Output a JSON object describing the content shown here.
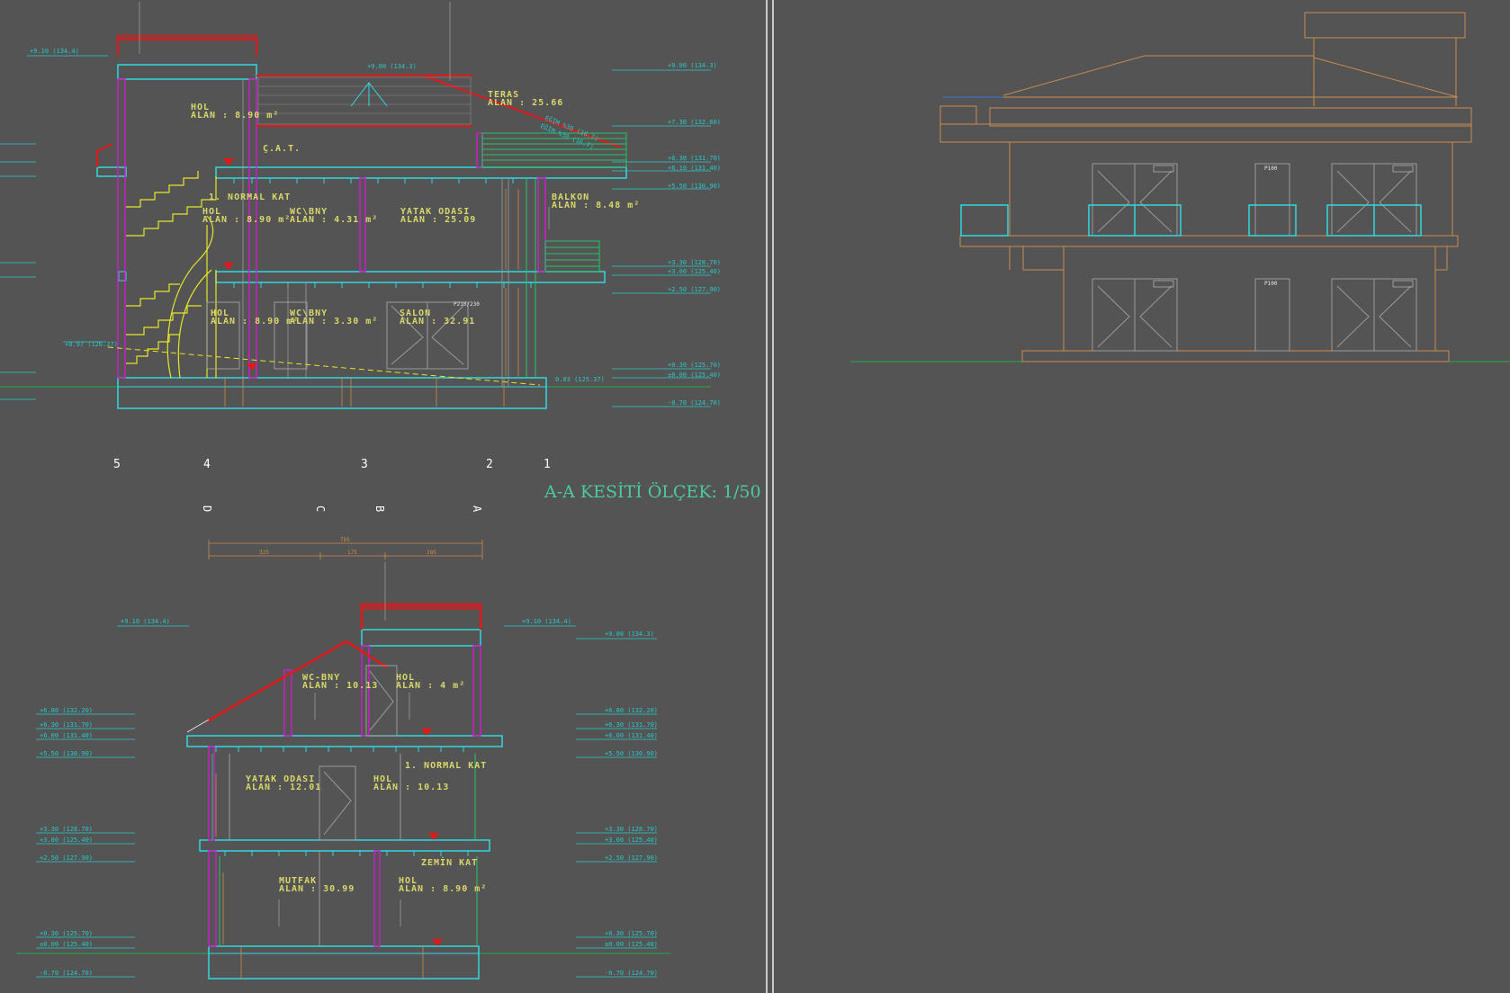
{
  "drawing": {
    "title": "A-A KESİTİ ÖLÇEK: 1/50",
    "axis_numbers": [
      "5",
      "4",
      "3",
      "2",
      "1"
    ],
    "axis_letters": [
      "D",
      "C",
      "B",
      "A"
    ],
    "colors": {
      "background": "#545454",
      "cyan": "#2fd9e0",
      "magenta": "#c81fc8",
      "yellow": "#e6e628",
      "red": "#e41818",
      "green": "#22c864",
      "orange": "#c88c50",
      "label_yellow": "#d8d86a",
      "elev_cyan": "#28c8c8",
      "title_green": "#4ccaa0",
      "white": "#e8e8e8",
      "gray": "#9a9a9a"
    }
  },
  "section_top": {
    "rooms": [
      {
        "name": "HOL",
        "area": "ALAN : 8.90 m²"
      },
      {
        "name": "TERAS",
        "area": "ALAN : 25.66"
      },
      {
        "name": "Ç.A.T.",
        "area": ""
      },
      {
        "name": "1. NORMAL KAT",
        "area": ""
      },
      {
        "name": "HOL",
        "area": "ALAN : 8.90 m²"
      },
      {
        "name": "WC\\BNY",
        "area": "ALAN : 4.31 m²"
      },
      {
        "name": "YATAK ODASI",
        "area": "ALAN : 25.09"
      },
      {
        "name": "BALKON",
        "area": "ALAN : 8.48 m²"
      },
      {
        "name": "HOL",
        "area": "ALAN : 8.90 m²"
      },
      {
        "name": "WC\\BNY",
        "area": "ALAN : 3.30 m²"
      },
      {
        "name": "SALON",
        "area": "ALAN : 32.91"
      }
    ],
    "elevations_left": [
      "+9.10 (134.4)",
      "+0.97 (126.27)"
    ],
    "elevations_right": [
      "+9.00 (134.3)",
      "+7.30 (132.60)",
      "+6.30 (131.70)",
      "+6.10 (131.40)",
      "+5.50 (130.90)",
      "+3.30 (128.70)",
      "+3.00 (125.40)",
      "+2.50 (127.90)",
      "+0.30 (125.70)",
      "±0.00 (125.40)",
      "-0.70 (124.70)"
    ],
    "roof_labels": [
      "+9.00 (134.3)",
      "EĞİM %30 (16.7)",
      "EĞİM %30 (16.7)"
    ],
    "misc": [
      "P210/230",
      "0.03 (125.37)"
    ]
  },
  "section_bottom": {
    "rooms": [
      {
        "name": "WC-BNY",
        "area": "ALAN : 10.13"
      },
      {
        "name": "HOL",
        "area": "ALAN : 4 m²"
      },
      {
        "name": "1. NORMAL KAT",
        "area": ""
      },
      {
        "name": "YATAK ODASI",
        "area": "ALAN : 12.01"
      },
      {
        "name": "HOL",
        "area": "ALAN : 10.13"
      },
      {
        "name": "ZEMİN KAT",
        "area": ""
      },
      {
        "name": "MUTFAK",
        "area": "ALAN : 30.99"
      },
      {
        "name": "HOL",
        "area": "ALAN : 8.90 m²"
      }
    ],
    "dimensions": [
      "785",
      "325",
      "175",
      "285"
    ],
    "elevations_left": [
      "+9.10 (134.4)",
      "+6.80 (132.20)",
      "+6.30 (131.70)",
      "+6.00 (131.40)",
      "+5.50 (130.90)",
      "+3.30 (128.70)",
      "+3.00 (125.40)",
      "+2.50 (127.90)",
      "+0.30 (125.70)",
      "±0.00 (125.40)",
      "-0.70 (124.70)"
    ],
    "elevations_right": [
      "+9.10 (134.4)",
      "+9.00 (134.3)",
      "+6.80 (132.20)",
      "+6.30 (131.70)",
      "+6.00 (131.40)",
      "+5.50 (130.90)",
      "+3.30 (128.70)",
      "+3.00 (125.40)",
      "+2.50 (127.90)",
      "+0.30 (125.70)",
      "±0.00 (125.40)",
      "-0.70 (124.70)"
    ]
  },
  "elevation_view": {
    "window_tags": [
      "P100",
      "P100"
    ]
  }
}
